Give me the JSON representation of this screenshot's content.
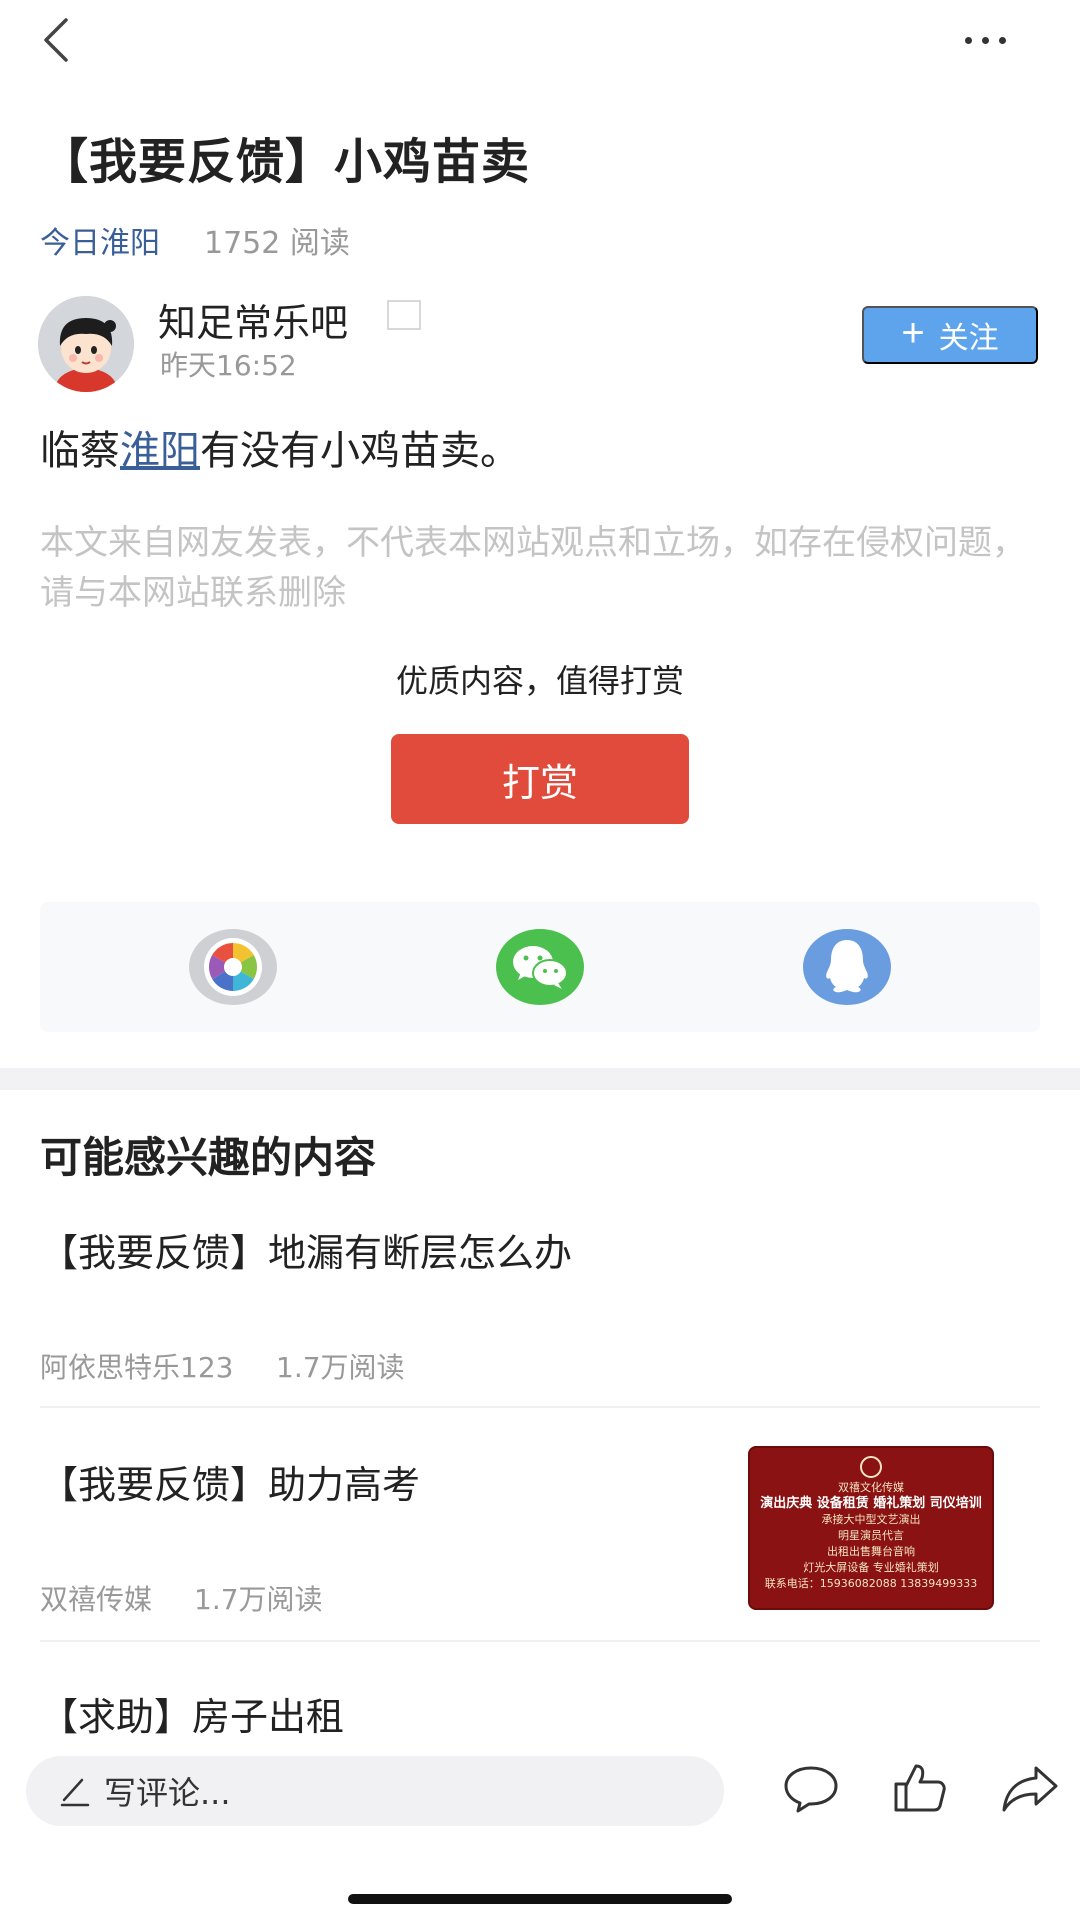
{
  "header": {
    "back_icon": "chevron-left-icon",
    "more_icon": "more-horizontal-icon"
  },
  "article": {
    "title": "【我要反馈】小鸡苗卖",
    "source": "今日淮阳",
    "reads": "1752 阅读",
    "author": {
      "name": "知足常乐吧",
      "time": "昨天16:52",
      "follow_label": "关注"
    },
    "content_before_link": "临蔡",
    "content_link": "淮阳",
    "content_after_link": "有没有小鸡苗卖。",
    "disclaimer": "本文来自网友发表，不代表本网站观点和立场，如存在侵权问题，请与本网站联系删除"
  },
  "reward": {
    "tip": "优质内容，值得打赏",
    "button_label": "打赏"
  },
  "share": {
    "icons": [
      "moments-icon",
      "wechat-icon",
      "qq-icon"
    ]
  },
  "recommendations": {
    "section_title": "可能感兴趣的内容",
    "items": [
      {
        "title": "【我要反馈】地漏有断层怎么办",
        "author": "阿依思特乐123",
        "reads": "1.7万阅读"
      },
      {
        "title": "【我要反馈】助力高考",
        "author": "双禧传媒",
        "reads": "1.7万阅读",
        "thumbnail": {
          "company": "双禧文化传媒",
          "line1": "演出庆典 设备租赁 婚礼策划 司仪培训",
          "line2": "承接大中型文艺演出",
          "line3": "明星演员代言",
          "line4": "出租出售舞台音响",
          "line5": "灯光大屏设备 专业婚礼策划",
          "line6": "联系电话：15936082088 13839499333"
        }
      },
      {
        "title": "【求助】房子出租"
      }
    ]
  },
  "bottom_bar": {
    "comment_placeholder": "写评论...",
    "icons": [
      "pen-icon",
      "comment-icon",
      "like-icon",
      "share-icon"
    ]
  },
  "colors": {
    "link": "#3a5f98",
    "follow_button": "#5ea4ec",
    "reward_button": "#e04b3c",
    "wechat_green": "#4cc04f",
    "qq_blue": "#6a9de0"
  }
}
